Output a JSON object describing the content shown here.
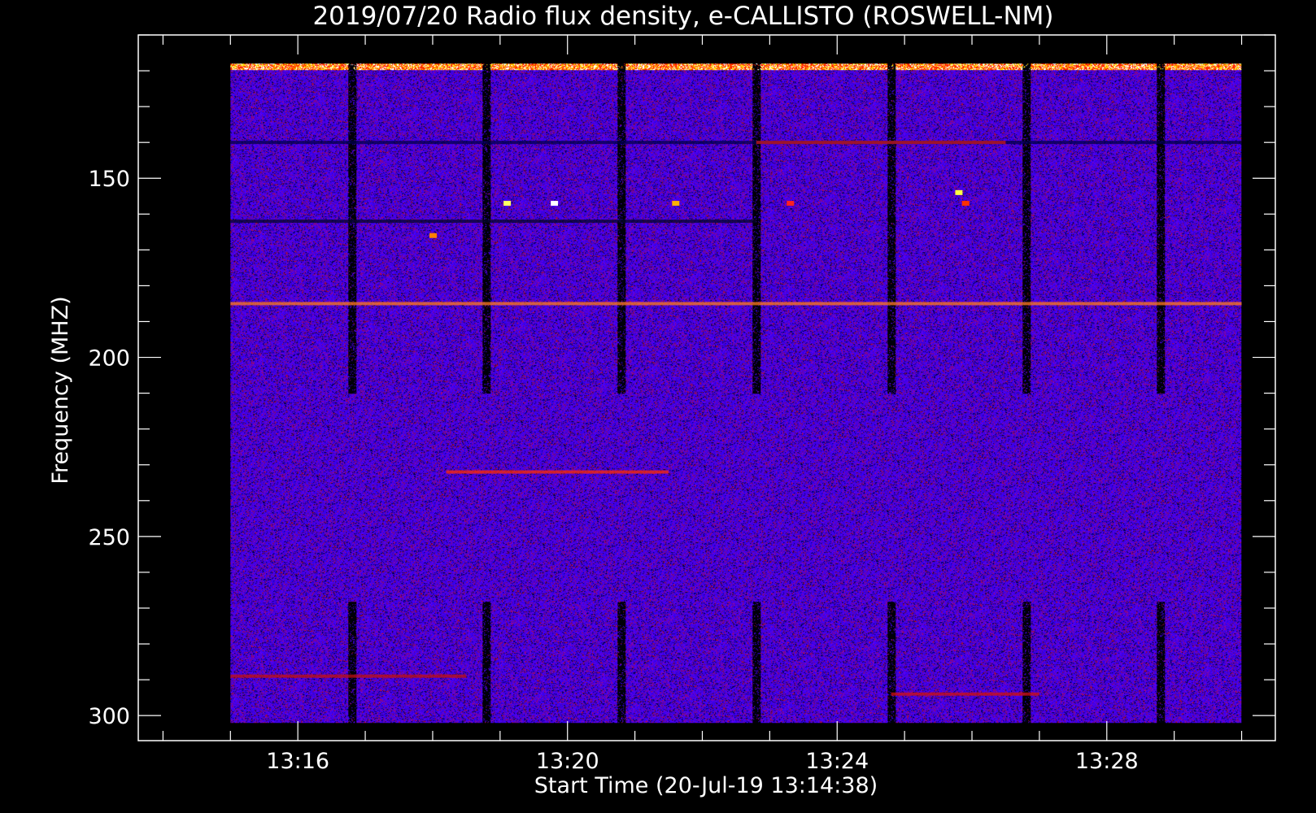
{
  "chart_data": {
    "type": "heatmap",
    "title": "2019/07/20  Radio flux density, e-CALLISTO (ROSWELL-NM)",
    "xlabel": "Start Time (20-Jul-19 13:14:38)",
    "ylabel": "Frequency (MHZ)",
    "x_range_minutes": [
      13.633,
      30.5
    ],
    "x_data_extent_minutes": [
      15.0,
      30.0
    ],
    "x_ticks": [
      {
        "label": "13:16",
        "minute": 16
      },
      {
        "label": "13:20",
        "minute": 20
      },
      {
        "label": "13:24",
        "minute": 24
      },
      {
        "label": "13:28",
        "minute": 28
      }
    ],
    "x_minor_step_minutes": 1,
    "y_range": [
      110,
      307
    ],
    "y_inverted": true,
    "y_data_extent": [
      118,
      302
    ],
    "y_ticks": [
      150,
      200,
      250,
      300
    ],
    "y_minor_step": 10,
    "colormap": [
      "#000000",
      "#0000ff",
      "#7f00ff",
      "#ff0000",
      "#ffff00",
      "#ffffff"
    ],
    "background_color": "#3a14d6",
    "frame_color": "#ffffff",
    "gaps_minutes": [
      16.8,
      18.8,
      20.8,
      22.8,
      24.8,
      26.8,
      28.8
    ],
    "gap_width_minutes": 0.12,
    "features": [
      {
        "kind": "band",
        "freq": 140,
        "t_range": [
          15.0,
          30.0
        ],
        "color": "#00004a"
      },
      {
        "kind": "band",
        "freq": 162,
        "t_range": [
          15.0,
          22.8
        ],
        "color": "#06062a"
      },
      {
        "kind": "band",
        "freq": 185,
        "t_range": [
          15.0,
          30.0
        ],
        "color": "#ff7a1a"
      },
      {
        "kind": "band",
        "freq": 232,
        "t_range": [
          18.2,
          21.5
        ],
        "color": "#ff2a00"
      },
      {
        "kind": "band",
        "freq": 289,
        "t_range": [
          15.0,
          18.5
        ],
        "color": "#c01010"
      },
      {
        "kind": "band",
        "freq": 294,
        "t_range": [
          24.8,
          27.0
        ],
        "color": "#d01010"
      },
      {
        "kind": "band",
        "freq": 140,
        "t_range": [
          22.8,
          26.5
        ],
        "color": "#cc1a1a"
      },
      {
        "kind": "dot",
        "t": 19.1,
        "freq": 157,
        "color": "#ffff60"
      },
      {
        "kind": "dot",
        "t": 19.8,
        "freq": 157,
        "color": "#ffffff"
      },
      {
        "kind": "dot",
        "t": 21.6,
        "freq": 157,
        "color": "#ffb000"
      },
      {
        "kind": "dot",
        "t": 23.3,
        "freq": 157,
        "color": "#ff2020"
      },
      {
        "kind": "dot",
        "t": 25.8,
        "freq": 154,
        "color": "#ffff40"
      },
      {
        "kind": "dot",
        "t": 25.9,
        "freq": 157,
        "color": "#ff3000"
      },
      {
        "kind": "dot",
        "t": 18.0,
        "freq": 166,
        "color": "#ff8000"
      }
    ]
  }
}
